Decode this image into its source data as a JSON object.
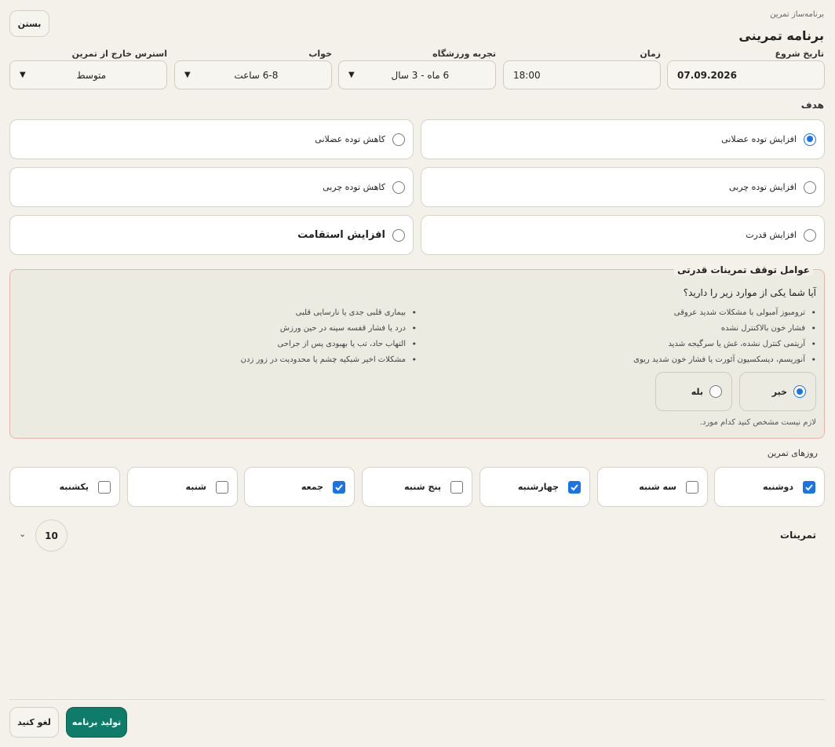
{
  "header": {
    "close_label": "بستن",
    "subtitle": "برنامه‌ساز تمرین",
    "title": "برنامه تمرینی"
  },
  "fields": {
    "start_date": {
      "label": "تاریخ شروع",
      "value": "07.09.2026"
    },
    "time": {
      "label": "زمان",
      "value": "18:00"
    },
    "experience": {
      "label": "تجربه ورزشگاه",
      "value": "6 ماه - 3 سال"
    },
    "sleep": {
      "label": "خواب",
      "value": "6-8 ساعت"
    },
    "stress": {
      "label": "استرس خارج از تمرین",
      "value": "متوسط"
    }
  },
  "goal": {
    "label": "هدف",
    "options": [
      {
        "label": "افزایش توده عضلانی",
        "selected": true
      },
      {
        "label": "کاهش توده عضلانی",
        "selected": false
      },
      {
        "label": "افزایش توده چربی",
        "selected": false
      },
      {
        "label": "کاهش توده چربی",
        "selected": false
      },
      {
        "label": "افزایش قدرت",
        "selected": false
      },
      {
        "label": "افزایش استقامت",
        "selected": false
      }
    ]
  },
  "stop_factors": {
    "title": "عوامل توقف تمرینات قدرتی",
    "question": "آیا شما یکی از موارد زیر را دارید؟",
    "right_items": [
      "ترومبوز آمبولی با مشکلات شدید عروقی",
      "فشار خون بالاکنترل نشده",
      "آریتمی کنترل نشده، غش یا سرگیجه شدید",
      "آنوریسم، دیسکسیون آئورت یا فشار خون شدید ریوی"
    ],
    "left_items": [
      "بیماری قلبی جدی یا نارسایی قلبی",
      "درد یا فشار قفسه سینه در حین ورزش",
      "التهاب حاد، تب یا بهبودی پس از جراحی",
      "مشکلات اخیر شبکیه چشم یا محدودیت در زور زدن"
    ],
    "no_label": "خیر",
    "yes_label": "بله",
    "selected": "no",
    "note": "لازم نیست مشخص کنید کدام مورد."
  },
  "days": {
    "label": "روزهای تمرین",
    "items": [
      {
        "label": "دوشنبه",
        "checked": true
      },
      {
        "label": "سه شنبه",
        "checked": false
      },
      {
        "label": "چهارشنبه",
        "checked": true
      },
      {
        "label": "پنج شنبه",
        "checked": false
      },
      {
        "label": "جمعه",
        "checked": true
      },
      {
        "label": "شنبه",
        "checked": false
      },
      {
        "label": "یکشنبه",
        "checked": false
      }
    ]
  },
  "exercises": {
    "label": "تمرینات",
    "count": "10"
  },
  "footer": {
    "generate_label": "تولید برنامه",
    "cancel_label": "لغو کنید"
  },
  "colors": {
    "accent": "#0f7c6a",
    "check": "#1a73e8",
    "warning_border": "#e8b4ad"
  }
}
